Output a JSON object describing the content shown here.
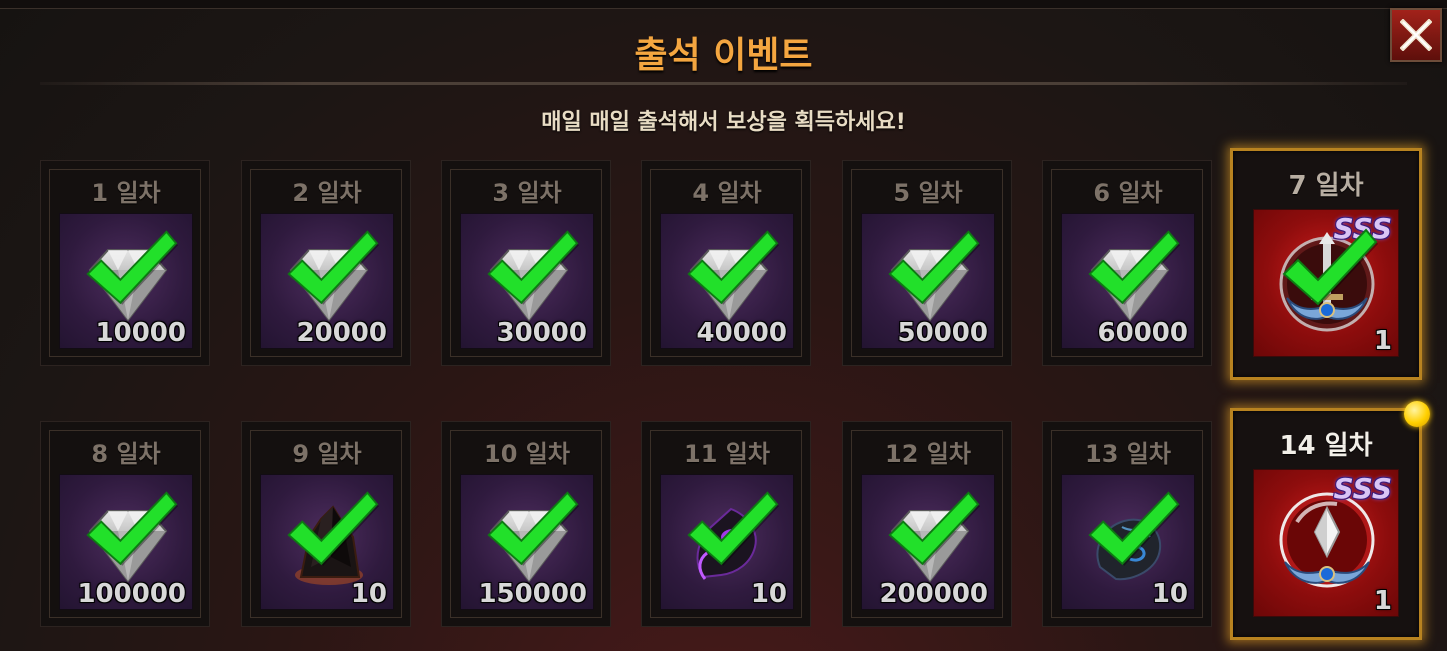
{
  "header": {
    "title": "출석 이벤트",
    "subtitle": "매일 매일 출석해서 보상을 획득하세요!"
  },
  "close_icon": "close-x-icon",
  "grade_badge": "SSS",
  "days": [
    {
      "label": "1 일차",
      "item": "gem",
      "qty": "10000",
      "checked": true
    },
    {
      "label": "2 일차",
      "item": "gem",
      "qty": "20000",
      "checked": true
    },
    {
      "label": "3 일차",
      "item": "gem",
      "qty": "30000",
      "checked": true
    },
    {
      "label": "4 일차",
      "item": "gem",
      "qty": "40000",
      "checked": true
    },
    {
      "label": "5 일차",
      "item": "gem",
      "qty": "50000",
      "checked": true
    },
    {
      "label": "6 일차",
      "item": "gem",
      "qty": "60000",
      "checked": true
    },
    {
      "label": "7 일차",
      "item": "sss-sword-emblem",
      "qty": "1",
      "checked": true
    },
    {
      "label": "8 일차",
      "item": "gem",
      "qty": "100000",
      "checked": true
    },
    {
      "label": "9 일차",
      "item": "dark-crystal",
      "qty": "10",
      "checked": true
    },
    {
      "label": "10 일차",
      "item": "gem",
      "qty": "150000",
      "checked": true
    },
    {
      "label": "11 일차",
      "item": "purple-ore",
      "qty": "10",
      "checked": true
    },
    {
      "label": "12 일차",
      "item": "gem",
      "qty": "200000",
      "checked": true
    },
    {
      "label": "13 일차",
      "item": "blue-ore",
      "qty": "10",
      "checked": true
    },
    {
      "label": "14 일차",
      "item": "sss-crystal-orb",
      "qty": "1",
      "checked": false
    }
  ],
  "colors": {
    "title": "#f4a640",
    "check": "#22e02a",
    "highlight_border": "#b88320",
    "slot_purple": "#2f1a3e",
    "slot_red": "#8e0d0d"
  }
}
